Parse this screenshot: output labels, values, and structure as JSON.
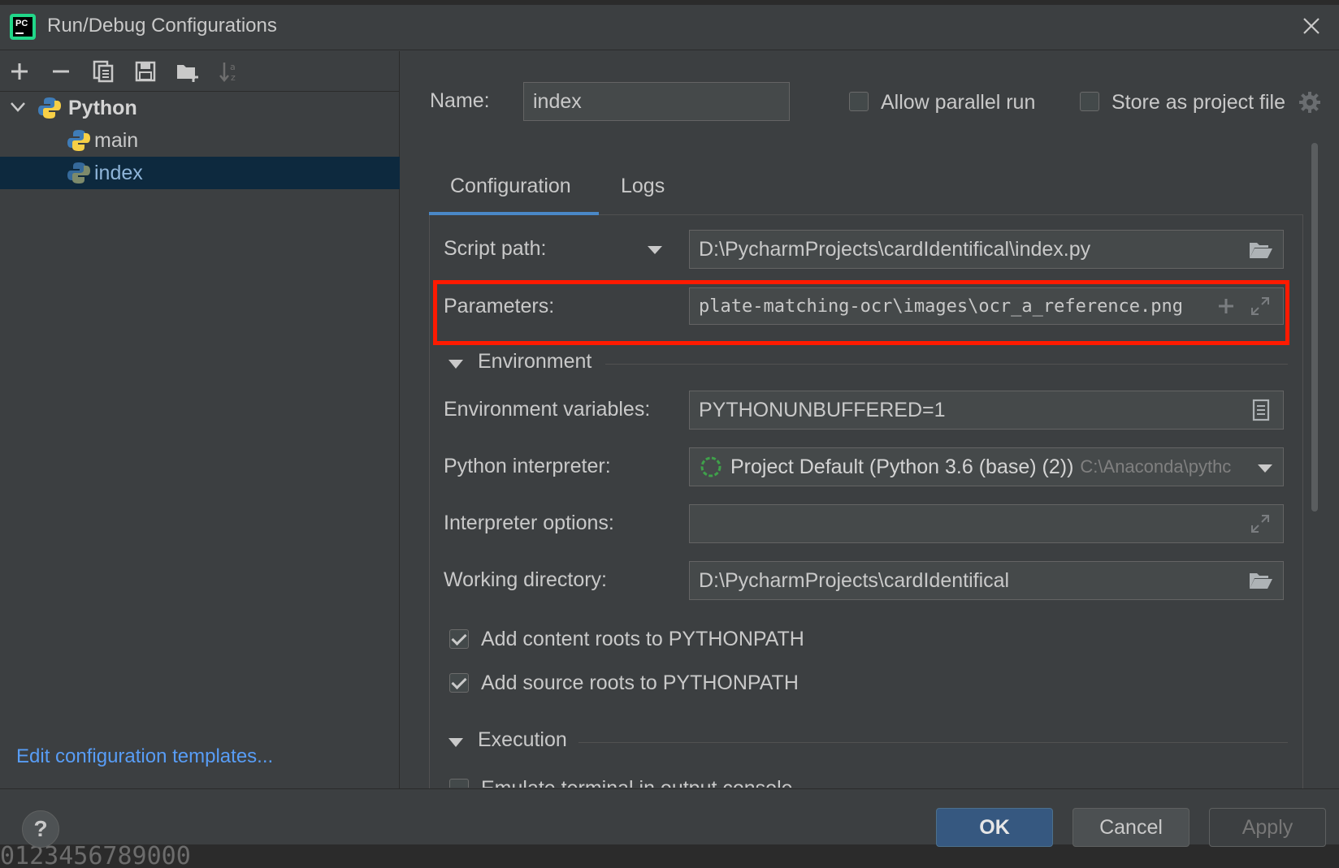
{
  "window": {
    "title": "Run/Debug Configurations",
    "app_icon_text": "PC"
  },
  "toolbar": {
    "add_icon": "plus-icon",
    "remove_icon": "minus-icon",
    "copy_icon": "copy-icon",
    "save_icon": "save-icon",
    "folder_icon": "new-folder-icon",
    "sort_icon": "sort-alpha-icon"
  },
  "tree": {
    "group_label": "Python",
    "items": [
      {
        "label": "main"
      },
      {
        "label": "index"
      }
    ]
  },
  "left_footer": {
    "edit_templates_link": "Edit configuration templates..."
  },
  "header": {
    "name_label": "Name:",
    "name_value": "index",
    "allow_parallel_label": "Allow parallel run",
    "allow_parallel_checked": false,
    "store_project_label": "Store as project file",
    "store_project_checked": false
  },
  "tabs": [
    {
      "label": "Configuration",
      "active": true
    },
    {
      "label": "Logs",
      "active": false
    }
  ],
  "form": {
    "script_path_label": "Script path:",
    "script_path_value": "D:\\PycharmProjects\\cardIdentifical\\index.py",
    "parameters_label": "Parameters:",
    "parameters_value": "plate-matching-ocr\\images\\ocr_a_reference.png",
    "environment_section": "Environment",
    "env_vars_label": "Environment variables:",
    "env_vars_value": "PYTHONUNBUFFERED=1",
    "interpreter_label": "Python interpreter:",
    "interpreter_value": "Project Default (Python 3.6 (base) (2))",
    "interpreter_path": "C:\\Anaconda\\pythc",
    "interp_options_label": "Interpreter options:",
    "interp_options_value": "",
    "working_dir_label": "Working directory:",
    "working_dir_value": "D:\\PycharmProjects\\cardIdentifical",
    "content_roots_label": "Add content roots to PYTHONPATH",
    "content_roots_checked": true,
    "source_roots_label": "Add source roots to PYTHONPATH",
    "source_roots_checked": true,
    "execution_section": "Execution",
    "emulate_terminal_label": "Emulate terminal in output console"
  },
  "footer": {
    "help_label": "?",
    "ok_label": "OK",
    "cancel_label": "Cancel",
    "apply_label": "Apply"
  },
  "backdrop": {
    "bottom_text": "0123456789000"
  },
  "colors": {
    "accent": "#4a88c7",
    "selection": "#0d293e",
    "highlight_box": "#ff1a00",
    "link": "#589df6",
    "ok_button": "#365880"
  }
}
